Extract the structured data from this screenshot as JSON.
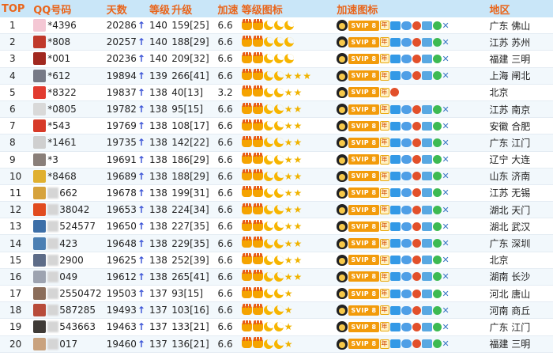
{
  "header": {
    "top": "TOP",
    "qq": "QQ号码",
    "days": "天数",
    "level": "等级",
    "upgrade": "升级",
    "speed": "加速",
    "level_icons": "等级图标",
    "speed_icons": "加速图标",
    "area": "地区"
  },
  "badge_labels": {
    "svip": "SVIP 8",
    "nian": "年"
  },
  "colors": {
    "header_bg": "#c9e6f8",
    "header_text": "#e9651b",
    "arrow": "#3a52d6",
    "alt_row": "#f2f8fc"
  },
  "rows": [
    {
      "rank": "1",
      "qq": "*4396",
      "days": "20286",
      "level": "140",
      "upgrade": "159[25]",
      "speed": "6.6",
      "area": "广东 佛山",
      "icons": [
        "crown",
        "crown",
        "moon",
        "moon",
        "moon"
      ],
      "avatar": "#f4c7d4",
      "blur": false
    },
    {
      "rank": "2",
      "qq": "*808",
      "days": "20257",
      "level": "140",
      "upgrade": "188[29]",
      "speed": "6.6",
      "area": "江苏 苏州",
      "icons": [
        "crown",
        "crown",
        "moon",
        "moon",
        "moon"
      ],
      "avatar": "#c0392b",
      "blur": false
    },
    {
      "rank": "3",
      "qq": "*001",
      "days": "20236",
      "level": "140",
      "upgrade": "209[32]",
      "speed": "6.6",
      "area": "福建 三明",
      "icons": [
        "crown",
        "crown",
        "moon",
        "moon",
        "moon"
      ],
      "avatar": "#a1281f",
      "blur": false
    },
    {
      "rank": "4",
      "qq": "*612",
      "days": "19894",
      "level": "139",
      "upgrade": "266[41]",
      "speed": "6.6",
      "area": "上海 闸北",
      "icons": [
        "crown",
        "crown",
        "moon",
        "moon",
        "star",
        "star",
        "star"
      ],
      "avatar": "#777a86",
      "blur": false
    },
    {
      "rank": "5",
      "qq": "*8322",
      "days": "19837",
      "level": "138",
      "upgrade": "40[13]",
      "speed": "3.2",
      "area": "北京",
      "icons": [
        "crown",
        "crown",
        "moon",
        "moon",
        "star",
        "star"
      ],
      "avatar": "#e23b2f",
      "blur": false
    },
    {
      "rank": "6",
      "qq": "*0805",
      "days": "19782",
      "level": "138",
      "upgrade": "95[15]",
      "speed": "6.6",
      "area": "江苏 南京",
      "icons": [
        "crown",
        "crown",
        "moon",
        "moon",
        "star",
        "star"
      ],
      "avatar": "#d9d9d9",
      "blur": false
    },
    {
      "rank": "7",
      "qq": "*543",
      "days": "19769",
      "level": "138",
      "upgrade": "108[17]",
      "speed": "6.6",
      "area": "安徽 合肥",
      "icons": [
        "crown",
        "crown",
        "moon",
        "moon",
        "star",
        "star"
      ],
      "avatar": "#d73a28",
      "blur": false
    },
    {
      "rank": "8",
      "qq": "*1461",
      "days": "19735",
      "level": "138",
      "upgrade": "142[22]",
      "speed": "6.6",
      "area": "广东 江门",
      "icons": [
        "crown",
        "crown",
        "moon",
        "moon",
        "star",
        "star"
      ],
      "avatar": "#cfcfcf",
      "blur": false
    },
    {
      "rank": "9",
      "qq": "*3",
      "days": "19691",
      "level": "138",
      "upgrade": "186[29]",
      "speed": "6.6",
      "area": "辽宁 大连",
      "icons": [
        "crown",
        "crown",
        "moon",
        "moon",
        "star",
        "star"
      ],
      "avatar": "#8a7f79",
      "blur": false
    },
    {
      "rank": "10",
      "qq": "*8468",
      "days": "19689",
      "level": "138",
      "upgrade": "188[29]",
      "speed": "6.6",
      "area": "山东 济南",
      "icons": [
        "crown",
        "crown",
        "moon",
        "moon",
        "star",
        "star"
      ],
      "avatar": "#e0b030",
      "blur": false
    },
    {
      "rank": "11",
      "qq": "662",
      "days": "19678",
      "level": "138",
      "upgrade": "199[31]",
      "speed": "6.6",
      "area": "江苏 无锡",
      "icons": [
        "crown",
        "crown",
        "moon",
        "moon",
        "star",
        "star"
      ],
      "avatar": "#d6a23c",
      "blur": true
    },
    {
      "rank": "12",
      "qq": "38042",
      "days": "19653",
      "level": "138",
      "upgrade": "224[34]",
      "speed": "6.6",
      "area": "湖北 天门",
      "icons": [
        "crown",
        "crown",
        "moon",
        "moon",
        "star",
        "star"
      ],
      "avatar": "#e14b1f",
      "blur": true
    },
    {
      "rank": "13",
      "qq": "524577",
      "days": "19650",
      "level": "138",
      "upgrade": "227[35]",
      "speed": "6.6",
      "area": "湖北 武汉",
      "icons": [
        "crown",
        "crown",
        "moon",
        "moon",
        "star",
        "star"
      ],
      "avatar": "#3d6fa8",
      "blur": true
    },
    {
      "rank": "14",
      "qq": "423",
      "days": "19648",
      "level": "138",
      "upgrade": "229[35]",
      "speed": "6.6",
      "area": "广东 深圳",
      "icons": [
        "crown",
        "crown",
        "moon",
        "moon",
        "star",
        "star"
      ],
      "avatar": "#4b7fb3",
      "blur": true
    },
    {
      "rank": "15",
      "qq": "2900",
      "days": "19625",
      "level": "138",
      "upgrade": "252[39]",
      "speed": "6.6",
      "area": "北京",
      "icons": [
        "crown",
        "crown",
        "moon",
        "moon",
        "star",
        "star"
      ],
      "avatar": "#5d6c88",
      "blur": true
    },
    {
      "rank": "16",
      "qq": "049",
      "days": "19612",
      "level": "138",
      "upgrade": "265[41]",
      "speed": "6.6",
      "area": "湖南 长沙",
      "icons": [
        "crown",
        "crown",
        "moon",
        "moon",
        "star",
        "star"
      ],
      "avatar": "#9da3b0",
      "blur": true
    },
    {
      "rank": "17",
      "qq": "2550472",
      "days": "19503",
      "level": "137",
      "upgrade": "93[15]",
      "speed": "6.6",
      "area": "河北 唐山",
      "icons": [
        "crown",
        "crown",
        "moon",
        "moon",
        "star"
      ],
      "avatar": "#8b6d5a",
      "blur": true
    },
    {
      "rank": "18",
      "qq": "587285",
      "days": "19493",
      "level": "137",
      "upgrade": "103[16]",
      "speed": "6.6",
      "area": "河南 商丘",
      "icons": [
        "crown",
        "crown",
        "moon",
        "moon",
        "star"
      ],
      "avatar": "#b84b3a",
      "blur": true
    },
    {
      "rank": "19",
      "qq": "543663",
      "days": "19463",
      "level": "137",
      "upgrade": "133[21]",
      "speed": "6.6",
      "area": "广东 江门",
      "icons": [
        "crown",
        "crown",
        "moon",
        "moon",
        "star"
      ],
      "avatar": "#3f3a36",
      "blur": true
    },
    {
      "rank": "20",
      "qq": "017",
      "days": "19460",
      "level": "137",
      "upgrade": "136[21]",
      "speed": "6.6",
      "area": "福建 三明",
      "icons": [
        "crown",
        "crown",
        "moon",
        "moon",
        "star"
      ],
      "avatar": "#c9a27e",
      "blur": true
    }
  ]
}
